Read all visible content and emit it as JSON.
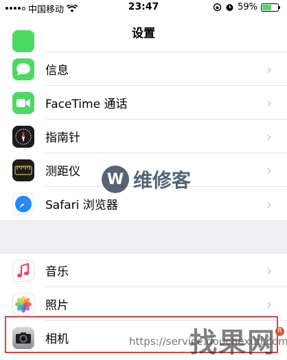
{
  "status_bar": {
    "carrier": "中国移动",
    "time": "23:47",
    "battery": "59%",
    "battery_level": 0.59,
    "signal_bars": 4
  },
  "nav": {
    "title": "设置"
  },
  "rows": [
    {
      "label": "信息",
      "icon": "messages-icon",
      "color": "#4cd964"
    },
    {
      "label": "FaceTime 通话",
      "icon": "facetime-icon",
      "color": "#4cd964"
    },
    {
      "label": "指南针",
      "icon": "compass-icon",
      "color": "#1c1c1e"
    },
    {
      "label": "测距仪",
      "icon": "measure-icon",
      "color": "#1c1c1e"
    },
    {
      "label": "Safari 浏览器",
      "icon": "safari-icon",
      "color": "#1a8cff"
    },
    {
      "label": "音乐",
      "icon": "music-icon",
      "color": "#ffffff"
    },
    {
      "label": "照片",
      "icon": "photos-icon",
      "color": "#ffffff"
    },
    {
      "label": "相机",
      "icon": "camera-icon",
      "color": "#8e8e93"
    }
  ],
  "watermarks": {
    "brand_letter": "W",
    "brand": "维修客",
    "url": "https://service.douchexun.com",
    "site": "找果网",
    "badge": "R"
  },
  "colors": {
    "highlight": "#d9413f",
    "separator": "#e3e3e6",
    "group_background": "#efeff4",
    "chevron": "#c7c7cc"
  }
}
